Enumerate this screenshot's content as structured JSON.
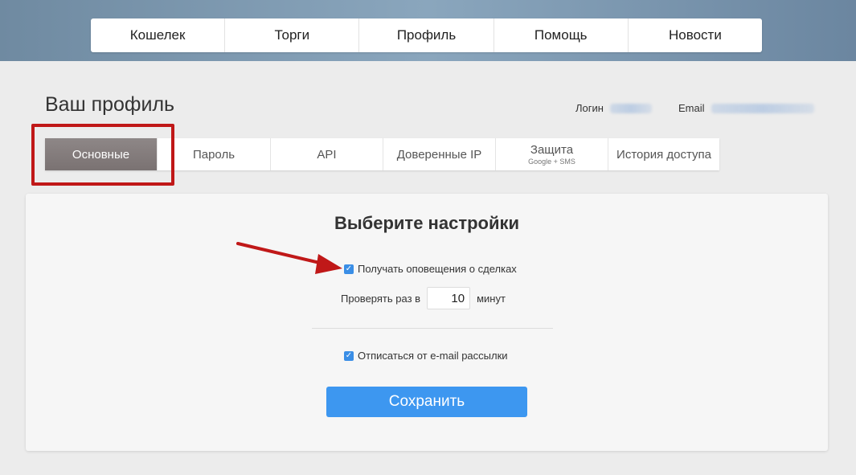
{
  "nav": {
    "items": [
      {
        "label": "Кошелек"
      },
      {
        "label": "Торги"
      },
      {
        "label": "Профиль"
      },
      {
        "label": "Помощь"
      },
      {
        "label": "Новости"
      }
    ]
  },
  "profile": {
    "title": "Ваш профиль",
    "login_label": "Логин",
    "email_label": "Email"
  },
  "tabs": [
    {
      "label": "Основные",
      "active": true
    },
    {
      "label": "Пароль"
    },
    {
      "label": "API"
    },
    {
      "label": "Доверенные IP"
    },
    {
      "label": "Защита",
      "sub": "Google + SMS"
    },
    {
      "label": "История доступа"
    }
  ],
  "settings": {
    "title": "Выберите настройки",
    "notify_label": "Получать оповещения о сделках",
    "notify_checked": true,
    "check_prefix": "Проверять раз в",
    "check_value": "10",
    "check_suffix": "минут",
    "unsubscribe_label": "Отписаться от e-mail рассылки",
    "unsubscribe_checked": true,
    "save_label": "Сохранить"
  },
  "colors": {
    "accent": "#3d97f0",
    "annotation": "#c01818",
    "active_tab": "#857d7d"
  }
}
